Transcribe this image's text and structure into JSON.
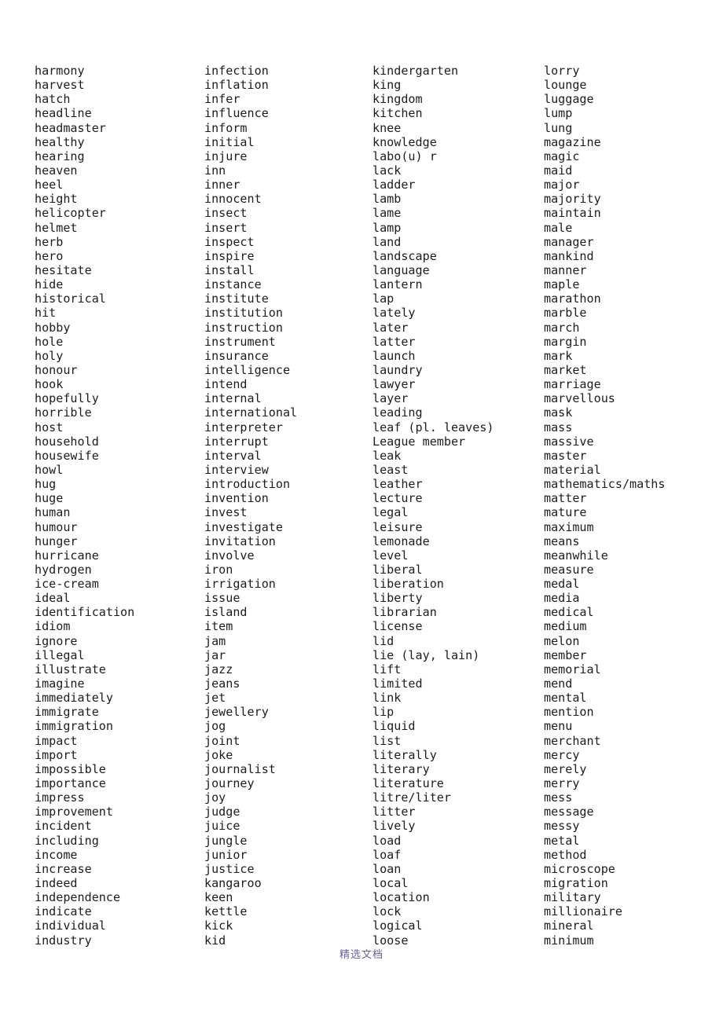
{
  "document": {
    "type": "vocabulary-word-list",
    "footer_text": "精选文档",
    "footer_color": "#6a5f93",
    "text_color": "#1c1c1c",
    "background_color": "#ffffff",
    "column_count": 4
  },
  "columns": [
    {
      "index": 0,
      "words": [
        "harmony",
        "harvest",
        "hatch",
        "headline",
        "headmaster",
        "healthy",
        "hearing",
        "heaven",
        "heel",
        "height",
        "helicopter",
        "helmet",
        "herb",
        "hero",
        "hesitate",
        "hide",
        "historical",
        "hit",
        "hobby",
        "hole",
        "holy",
        "honour",
        "hook",
        "hopefully",
        "horrible",
        "host",
        "household",
        "housewife",
        "howl",
        "hug",
        "huge",
        "human",
        "humour",
        "hunger",
        "hurricane",
        "hydrogen",
        "ice-cream",
        "ideal",
        "identification",
        "idiom",
        "ignore",
        "illegal",
        "illustrate",
        "imagine",
        "immediately",
        "immigrate",
        "immigration",
        "impact",
        "import",
        "impossible",
        "importance",
        "impress",
        "improvement",
        "incident",
        "including",
        "income",
        "increase",
        "indeed",
        "independence",
        "indicate",
        "individual",
        "industry"
      ]
    },
    {
      "index": 1,
      "words": [
        "infection",
        "inflation",
        "infer",
        "influence",
        "inform",
        "initial",
        "injure",
        "inn",
        "inner",
        "innocent",
        "insect",
        "insert",
        "inspect",
        "inspire",
        "install",
        "instance",
        "institute",
        "institution",
        "instruction",
        "instrument",
        "insurance",
        "intelligence",
        "intend",
        "internal",
        "international",
        "interpreter",
        "interrupt",
        "interval",
        "interview",
        "introduction",
        "invention",
        "invest",
        "investigate",
        "invitation",
        "involve",
        "iron",
        "irrigation",
        "issue",
        "island",
        "item",
        "jam",
        "jar",
        "jazz",
        "jeans",
        "jet",
        "jewellery",
        "jog",
        "joint",
        "joke",
        "journalist",
        "journey",
        "joy",
        "judge",
        "juice",
        "jungle",
        "junior",
        "justice",
        "kangaroo",
        "keen",
        "kettle",
        "kick",
        "kid"
      ]
    },
    {
      "index": 2,
      "words": [
        "kindergarten",
        "king",
        "kingdom",
        "kitchen",
        "knee",
        "knowledge",
        "labo(u) r",
        "lack",
        "ladder",
        "lamb",
        "lame",
        "lamp",
        "land",
        "landscape",
        "language",
        "lantern",
        "lap",
        "lately",
        "later",
        "latter",
        "launch",
        "laundry",
        "lawyer",
        "layer",
        "leading",
        "leaf (pl. leaves)",
        "League member",
        "leak",
        "least",
        "leather",
        "lecture",
        "legal",
        "leisure",
        "lemonade",
        "level",
        "liberal",
        "liberation",
        "liberty",
        "librarian",
        "license",
        "lid",
        "lie (lay, lain)",
        "lift",
        "limited",
        "link",
        "lip",
        "liquid",
        "list",
        "literally",
        "literary",
        "literature",
        "litre/liter",
        "litter",
        "lively",
        "load",
        "loaf",
        "loan",
        "local",
        "location",
        "lock",
        "logical",
        "loose"
      ]
    },
    {
      "index": 3,
      "words": [
        "lorry",
        "lounge",
        "luggage",
        "lump",
        "lung",
        "magazine",
        "magic",
        "maid",
        "major",
        "majority",
        "maintain",
        "male",
        "manager",
        "mankind",
        "manner",
        "maple",
        "marathon",
        "marble",
        "march",
        "margin",
        "mark",
        "market",
        "marriage",
        "marvellous",
        "mask",
        "mass",
        "massive",
        "master",
        "material",
        "mathematics/maths",
        "matter",
        "mature",
        "maximum",
        "means",
        "meanwhile",
        "measure",
        "medal",
        "media",
        "medical",
        "medium",
        "melon",
        "member",
        "memorial",
        "mend",
        "mental",
        "mention",
        "menu",
        "merchant",
        "mercy",
        "merely",
        "merry",
        "mess",
        "message",
        "messy",
        "metal",
        "method",
        "microscope",
        "migration",
        "military",
        "millionaire",
        "mineral",
        "minimum"
      ]
    }
  ]
}
